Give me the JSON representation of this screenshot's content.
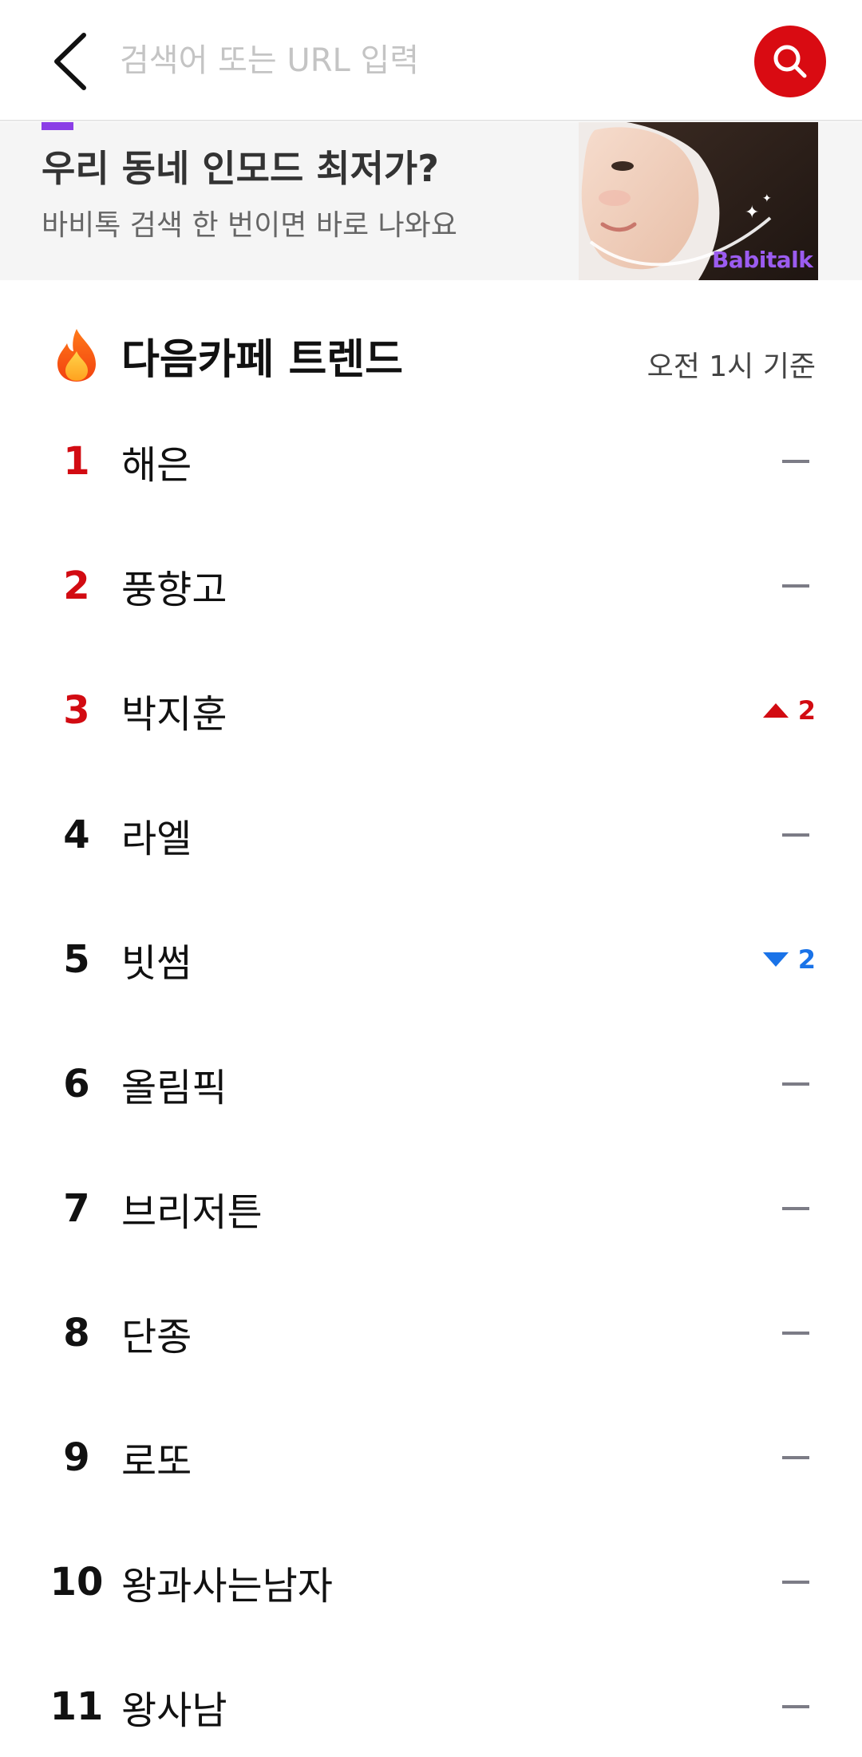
{
  "search": {
    "placeholder": "검색어 또는 URL 입력",
    "accent_color": "#d90b12"
  },
  "banner": {
    "title": "우리 동네 인모드 최저가?",
    "subtitle": "바비톡 검색 한 번이면 바로 나와요",
    "brand": "Babitalk"
  },
  "trend": {
    "title": "다음카페 트렌드",
    "time": "오전 1시 기준",
    "items": [
      {
        "rank": "1",
        "keyword": "해은",
        "change": "none",
        "delta": ""
      },
      {
        "rank": "2",
        "keyword": "풍향고",
        "change": "none",
        "delta": ""
      },
      {
        "rank": "3",
        "keyword": "박지훈",
        "change": "up",
        "delta": "2"
      },
      {
        "rank": "4",
        "keyword": "라엘",
        "change": "none",
        "delta": ""
      },
      {
        "rank": "5",
        "keyword": "빗썸",
        "change": "down",
        "delta": "2"
      },
      {
        "rank": "6",
        "keyword": "올림픽",
        "change": "none",
        "delta": ""
      },
      {
        "rank": "7",
        "keyword": "브리저튼",
        "change": "none",
        "delta": ""
      },
      {
        "rank": "8",
        "keyword": "단종",
        "change": "none",
        "delta": ""
      },
      {
        "rank": "9",
        "keyword": "로또",
        "change": "none",
        "delta": ""
      },
      {
        "rank": "10",
        "keyword": "왕과사는남자",
        "change": "none",
        "delta": ""
      },
      {
        "rank": "11",
        "keyword": "왕사남",
        "change": "none",
        "delta": ""
      }
    ]
  },
  "colors": {
    "rank_top": "#d20b12",
    "up": "#d20b12",
    "down": "#1a73e8",
    "no_change": "#7c7c86"
  }
}
